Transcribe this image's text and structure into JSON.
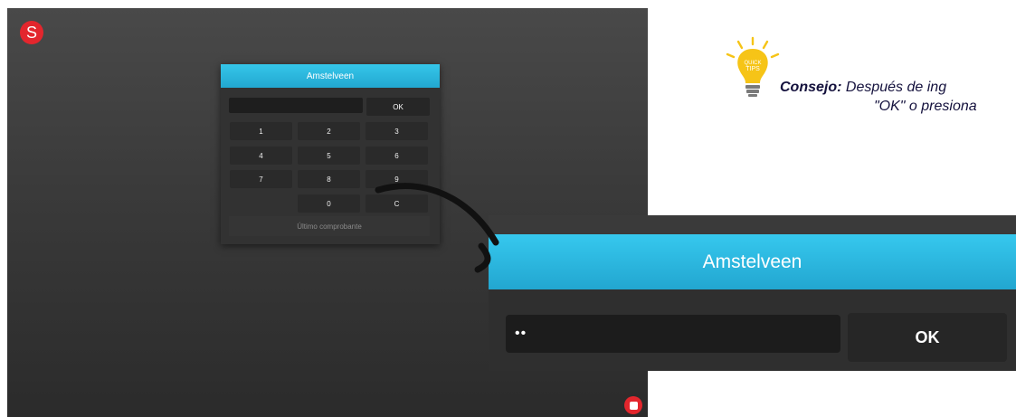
{
  "app": {
    "logo_letter": "S"
  },
  "dialog": {
    "title": "Amstelveen",
    "ok_label": "OK",
    "keys": [
      "1",
      "2",
      "3",
      "4",
      "5",
      "6",
      "7",
      "8",
      "9",
      "0",
      "C"
    ],
    "last_receipt_label": "Último comprobante"
  },
  "zoom": {
    "title": "Amstelveen",
    "pin_value": "••",
    "ok_label": "OK"
  },
  "tip": {
    "badge_line1": "QUICK",
    "badge_line2": "TIPS",
    "label": "Consejo:",
    "line1": "Después de ing",
    "line2": "\"OK\" o presiona"
  },
  "colors": {
    "accent_blue": "#2bb8e0",
    "brand_red": "#e3262d",
    "bulb_yellow": "#f6c417",
    "tip_text": "#14113d"
  }
}
